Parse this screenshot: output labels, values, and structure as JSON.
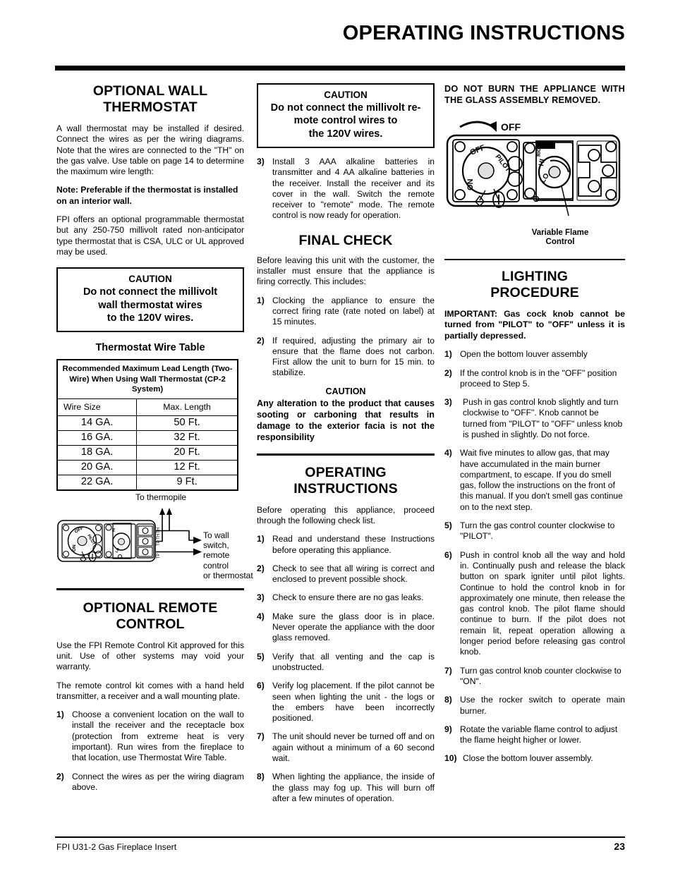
{
  "header": {
    "title": "OPERATING INSTRUCTIONS"
  },
  "footer": {
    "left": "FPI U31-2 Gas Fireplace Insert",
    "page_number": "23"
  },
  "left_column": {
    "thermostat": {
      "title_line1": "OPTIONAL WALL",
      "title_line2": "THERMOSTAT",
      "para1": "A wall thermostat may be installed if desired. Connect the wires as per the wiring diagrams. Note that the wires are  connected to the \"TH\" on the gas valve. Use table on page 14 to determine the maximum wire length:",
      "note": "Note: Preferable if the thermostat is installed on an interior wall.",
      "para2": "FPI offers an optional programmable thermostat but any 250-750 millivolt rated non-anticipator type thermostat that is CSA, ULC or UL approved may be used."
    },
    "caution_box": {
      "title": "CAUTION",
      "line1": "Do not connect the millivolt",
      "line2": "wall thermostat wires",
      "line3": "to the 120V wires."
    },
    "wire_table": {
      "caption": "Thermostat Wire Table",
      "header": "Recommended Maximum Lead Length (Two-Wire) When Using Wall Thermostat (CP-2 System)",
      "columns": [
        "Wire Size",
        "Max. Length"
      ],
      "rows": [
        [
          "14 GA.",
          "50 Ft."
        ],
        [
          "16 GA.",
          "32 Ft."
        ],
        [
          "18 GA.",
          "20 Ft."
        ],
        [
          "20 GA.",
          "12 Ft."
        ],
        [
          "22 GA.",
          "9 Ft."
        ]
      ]
    },
    "valve_diagram": {
      "label_top": "To thermopile",
      "label_right_line1": "To wall switch,",
      "label_right_line2": "remote control",
      "label_right_line3": "or thermostat",
      "knob_off": "OFF",
      "knob_pilot": "PILOT",
      "knob_on": "ON",
      "terminal_th": "TH",
      "terminal_tp": "TP",
      "terminal_tpth": "TP TH"
    },
    "remote": {
      "title_line1": "OPTIONAL REMOTE",
      "title_line2": "CONTROL",
      "para1": "Use the FPI Remote Control Kit  approved for this unit. Use of other systems may void your warranty.",
      "para2": "The remote control kit comes with a hand held transmitter, a receiver and a wall mounting plate.",
      "steps": [
        {
          "num": "1)",
          "text": "Choose a convenient location on the wall to install the receiver and the receptacle box (protection from extreme heat is very important). Run wires from the fireplace to that location, use Thermostat Wire Table."
        },
        {
          "num": "2)",
          "text": "Connect the wires as per the wiring diagram above."
        }
      ]
    }
  },
  "mid_column": {
    "caution_box": {
      "title": "CAUTION",
      "line1": "Do not connect the millivolt re-",
      "line2": "mote control wires to",
      "line3": "the 120V wires."
    },
    "step3": {
      "num": "3)",
      "text": "Install 3 AAA alkaline batteries in transmitter and 4 AA alkaline batteries in  the receiver. Install the receiver and its cover in the wall. Switch the   remote receiver to \"remote\" mode. The remote control is now ready for operation."
    },
    "final_check": {
      "title": "FINAL CHECK",
      "intro": "Before leaving this unit with the customer, the installer must ensure that the appliance is firing correctly. This includes:",
      "steps": [
        {
          "num": "1)",
          "text": "Clocking the appliance to ensure the correct firing rate (rate noted on label) at 15 minutes."
        },
        {
          "num": "2)",
          "text": "If required, adjusting the primary air to ensure that the flame does not carbon. First allow the unit to burn for 15 min. to stabilize."
        }
      ],
      "caution_title": "CAUTION",
      "caution_body": "Any alteration to the product that causes sooting or carboning that results in damage to the exterior facia is not the responsibility"
    },
    "operating": {
      "title_line1": "OPERATING",
      "title_line2": "INSTRUCTIONS",
      "intro": "Before operating this appliance, proceed through the following check list.",
      "steps": [
        {
          "num": "1)",
          "text": "Read and understand these Instructions before  operating this appliance."
        },
        {
          "num": "2)",
          "text": "Check to see that all wiring is correct and enclosed to prevent possible shock."
        },
        {
          "num": "3)",
          "text": "Check to ensure there are no gas leaks."
        },
        {
          "num": "4)",
          "text": "Make sure the glass door is in place. Never operate the appliance with the door glass removed."
        },
        {
          "num": "5)",
          "text": "Verify that all venting and the cap is unobstructed."
        },
        {
          "num": "6)",
          "text": "Verify log placement. If the pilot cannot be seen when lighting the unit - the logs or the embers have been incorrectly positioned."
        },
        {
          "num": "7)",
          "text": "The unit should never be turned off and on again without a minimum of a 60 second wait."
        },
        {
          "num": "8)",
          "text": "When lighting the appliance, the inside of the glass may fog up. This will burn off after a few minutes of operation."
        }
      ]
    }
  },
  "right_column": {
    "warning": "DO NOT BURN THE APPLIANCE WITH THE GLASS ASSEMBLY REMOVED.",
    "valve_diagram": {
      "off_label": "OFF",
      "knob_off": "OFF",
      "knob_pilot": "PILOT",
      "knob_on": "ON",
      "flame_hi": "HI",
      "flame_lo": "LO",
      "flame_right": "RIGHT",
      "caption_line1": "Variable Flame",
      "caption_line2": "Control"
    },
    "lighting": {
      "title_line1": "LIGHTING",
      "title_line2": "PROCEDURE",
      "important": "IMPORTANT:  Gas cock knob cannot be turned from \"PILOT\" to \"OFF\" unless it is partially depressed.",
      "steps": [
        {
          "num": "1)",
          "text": "Open the bottom louver assembly"
        },
        {
          "num": "2)",
          "text": "If the control knob is in the \"OFF\" position proceed to Step 5."
        },
        {
          "num": "3)",
          "text": "Push in gas control knob slightly and turn clockwise to \"OFF\".  Knob cannot be turned from \"PILOT\" to \"OFF\" unless knob is pushed in slightly.  Do not force."
        },
        {
          "num": "4)",
          "text": "Wait five minutes to allow gas, that may have accumulated in the main burner compartment, to escape. If you do smell gas, follow the instructions on the front of this manual. If you don't smell gas continue on to the next step."
        },
        {
          "num": "5)",
          "text": "Turn the gas control counter clockwise to \"PILOT\"."
        },
        {
          "num": "6)",
          "text": "Push in control knob all the way and hold in. Continually push and release the black button on spark igniter until pilot lights. Continue to hold the control knob in for approximately one minute, then release the gas control knob. The pilot flame should continue to burn. If the pilot does not remain lit, repeat operation allowing a longer period before releasing gas control knob."
        },
        {
          "num": "7)",
          "text": "Turn gas control knob counter clockwise to \"ON\"."
        },
        {
          "num": "8)",
          "text": "Use the rocker switch to operate main burner."
        },
        {
          "num": "9)",
          "text": "Rotate the variable flame control to adjust the flame height higher or lower."
        },
        {
          "num": "10)",
          "text": "Close the bottom louver assembly."
        }
      ]
    }
  }
}
